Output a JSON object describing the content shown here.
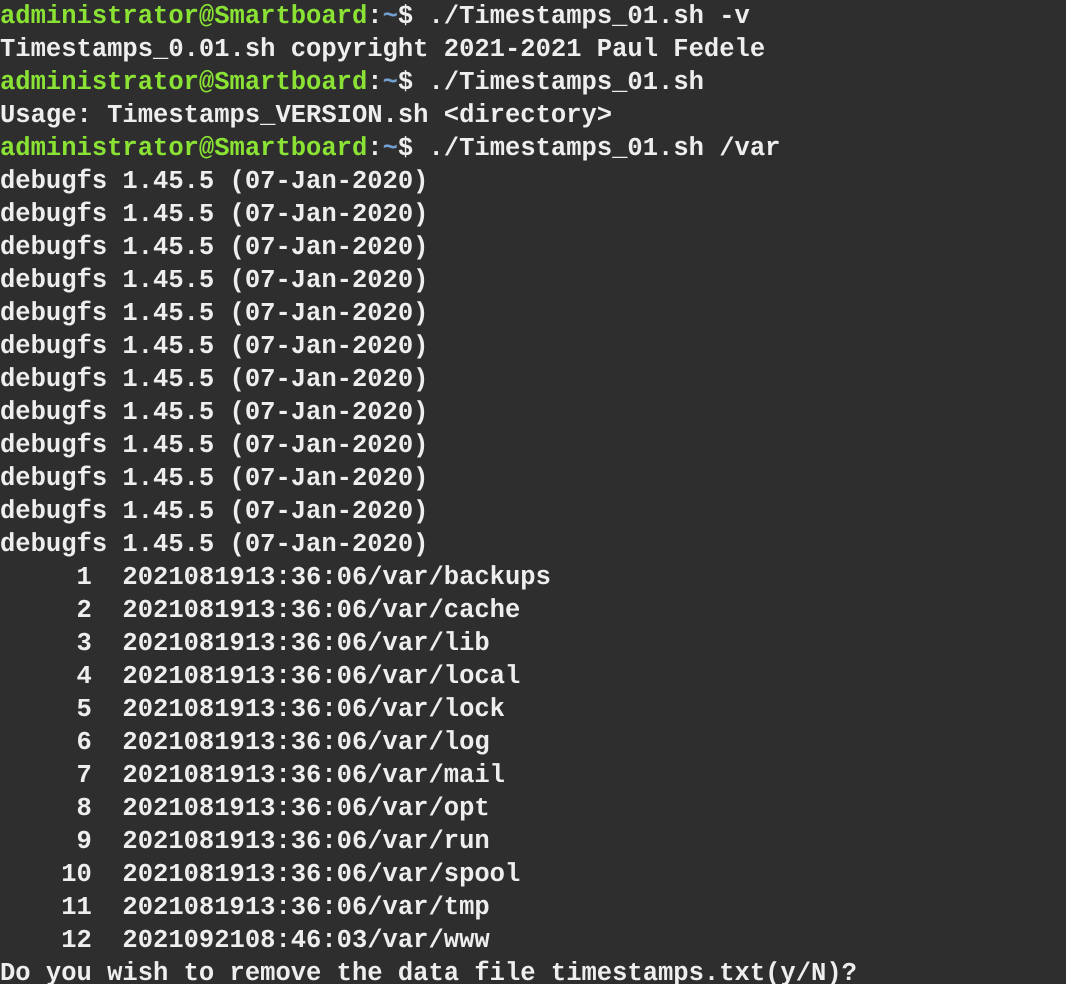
{
  "prompt": {
    "user_host": "administrator@Smartboard",
    "sep": ":",
    "path": "~",
    "dollar": "$ "
  },
  "cmd1": "./Timestamps_01.sh -v",
  "out1": "Timestamps_0.01.sh copyright 2021-2021 Paul Fedele",
  "cmd2": "./Timestamps_01.sh",
  "out2": "Usage: Timestamps_VERSION.sh <directory>",
  "cmd3": "./Timestamps_01.sh /var",
  "debugfs_line": "debugfs 1.45.5 (07-Jan-2020)",
  "debugfs_count": 12,
  "entries": [
    {
      "n": "     1",
      "ts": "2021081913:36:06",
      "path": "/var/backups"
    },
    {
      "n": "     2",
      "ts": "2021081913:36:06",
      "path": "/var/cache"
    },
    {
      "n": "     3",
      "ts": "2021081913:36:06",
      "path": "/var/lib"
    },
    {
      "n": "     4",
      "ts": "2021081913:36:06",
      "path": "/var/local"
    },
    {
      "n": "     5",
      "ts": "2021081913:36:06",
      "path": "/var/lock"
    },
    {
      "n": "     6",
      "ts": "2021081913:36:06",
      "path": "/var/log"
    },
    {
      "n": "     7",
      "ts": "2021081913:36:06",
      "path": "/var/mail"
    },
    {
      "n": "     8",
      "ts": "2021081913:36:06",
      "path": "/var/opt"
    },
    {
      "n": "     9",
      "ts": "2021081913:36:06",
      "path": "/var/run"
    },
    {
      "n": "    10",
      "ts": "2021081913:36:06",
      "path": "/var/spool"
    },
    {
      "n": "    11",
      "ts": "2021081913:36:06",
      "path": "/var/tmp"
    },
    {
      "n": "    12",
      "ts": "2021092108:46:03",
      "path": "/var/www"
    }
  ],
  "question": "Do you wish to remove the data file timestamps.txt(y/N)?"
}
